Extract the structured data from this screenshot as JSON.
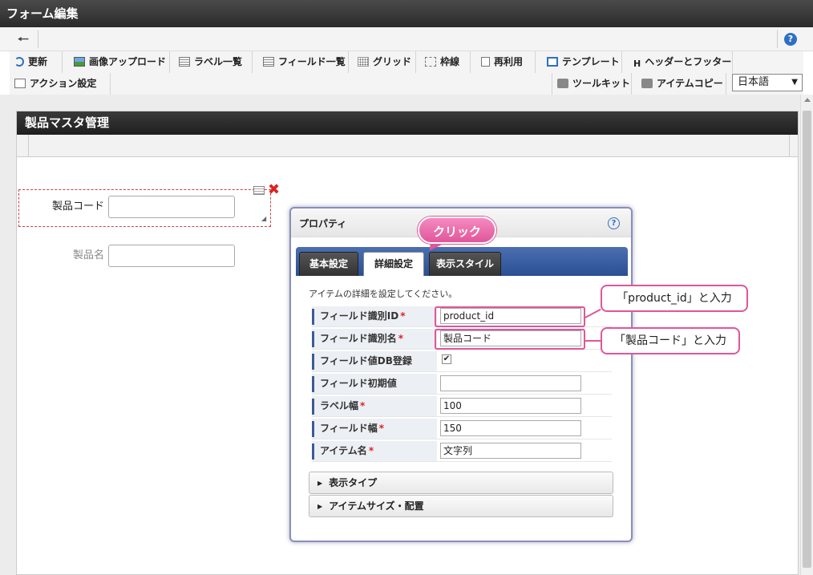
{
  "window": {
    "title": "フォーム編集"
  },
  "toolbar": {
    "row1": [
      {
        "label": "更新",
        "icon": "refresh-icon"
      },
      {
        "label": "画像アップロード",
        "icon": "image-upload-icon"
      },
      {
        "label": "ラベル一覧",
        "icon": "list-icon"
      },
      {
        "label": "フィールド一覧",
        "icon": "list-icon"
      },
      {
        "label": "グリッド",
        "icon": "grid-icon"
      },
      {
        "label": "枠線",
        "icon": "frame-icon"
      },
      {
        "label": "再利用",
        "icon": "reuse-icon"
      },
      {
        "label": "テンプレート",
        "icon": "template-icon"
      },
      {
        "label": "ヘッダーとフッター",
        "icon": "header-icon"
      }
    ],
    "row2": [
      {
        "label": "アクション設定",
        "icon": "action-icon"
      },
      {
        "label": "ツールキット",
        "icon": "toolkit-icon"
      },
      {
        "label": "アイテムコピー",
        "icon": "item-copy-icon"
      }
    ],
    "header_icon_glyph": "H",
    "language": "日本語"
  },
  "form": {
    "title": "製品マスタ管理",
    "items": [
      {
        "label": "製品コード",
        "value": ""
      },
      {
        "label": "製品名",
        "value": ""
      }
    ]
  },
  "panel": {
    "title": "プロパティ",
    "help_glyph": "?",
    "tabs": [
      {
        "label": "基本設定",
        "active": false
      },
      {
        "label": "詳細設定",
        "active": true
      },
      {
        "label": "表示スタイル",
        "active": false
      }
    ],
    "description": "アイテムの詳細を設定してください。",
    "rows": [
      {
        "label": "フィールド識別ID",
        "required": true,
        "type": "input",
        "value": "product_id"
      },
      {
        "label": "フィールド識別名",
        "required": true,
        "type": "input",
        "value": "製品コード"
      },
      {
        "label": "フィールド値DB登録",
        "required": false,
        "type": "checkbox",
        "value": "✔"
      },
      {
        "label": "フィールド初期値",
        "required": false,
        "type": "input",
        "value": ""
      },
      {
        "label": "ラベル幅",
        "required": true,
        "type": "input",
        "value": "100"
      },
      {
        "label": "フィールド幅",
        "required": true,
        "type": "input",
        "value": "150"
      },
      {
        "label": "アイテム名",
        "required": true,
        "type": "input",
        "value": "文字列"
      }
    ],
    "sections": [
      "表示タイプ",
      "アイテムサイズ・配置"
    ]
  },
  "annotations": {
    "click": "クリック",
    "callout_id": "「product_id」と入力",
    "callout_name": "「製品コード」と入力",
    "accent_color": "#e0569a"
  }
}
